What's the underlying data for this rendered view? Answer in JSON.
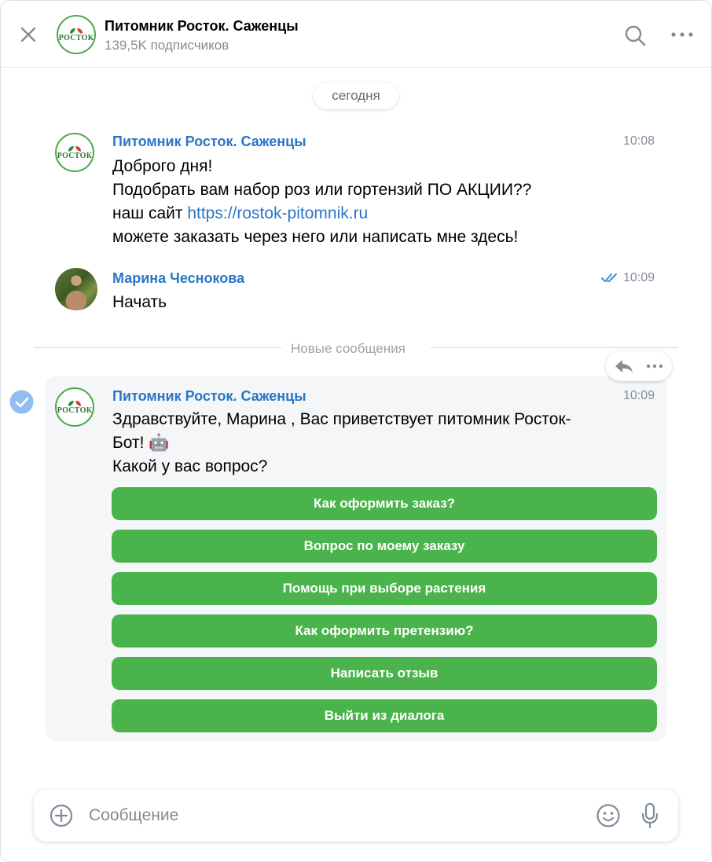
{
  "header": {
    "title": "Питомник Росток. Саженцы",
    "subscribers": "139,5K подписчиков",
    "logo_text": "РОСТОК"
  },
  "date_separator": "сегодня",
  "messages": [
    {
      "sender": "Питомник Росток. Саженцы",
      "time": "10:08",
      "lines": [
        "Доброго дня!",
        "Подобрать вам набор роз или гортензий ПО АКЦИИ??"
      ],
      "site_prefix": "наш сайт ",
      "site_link": "https://rostok-pitomnik.ru",
      "last_line": "можете заказать через него или написать мне здесь!"
    },
    {
      "sender": "Марина Чеснокова",
      "time": "10:09",
      "text": "Начать",
      "status": "read"
    }
  ],
  "new_messages_label": "Новые сообщения",
  "bot_message": {
    "sender": "Питомник Росток. Саженцы",
    "time": "10:09",
    "line1": "Здравствуйте, Марина , Вас приветствует питомник Росток-",
    "line2": "Бот!  🤖",
    "line3": "Какой у вас вопрос?",
    "buttons": [
      "Как оформить заказ?",
      "Вопрос по моему заказу",
      "Помощь при выборе растения",
      "Как оформить претензию?",
      "Написать отзыв",
      "Выйти из диалога"
    ]
  },
  "composer": {
    "placeholder": "Сообщение"
  },
  "colors": {
    "accent": "#2a76c6",
    "button_green": "#4bb34b",
    "muted": "#818c99"
  },
  "icons": [
    "close-icon",
    "search-icon",
    "more-icon",
    "reply-icon",
    "check-icon",
    "plus-icon",
    "emoji-icon",
    "mic-icon",
    "double-check-icon"
  ]
}
